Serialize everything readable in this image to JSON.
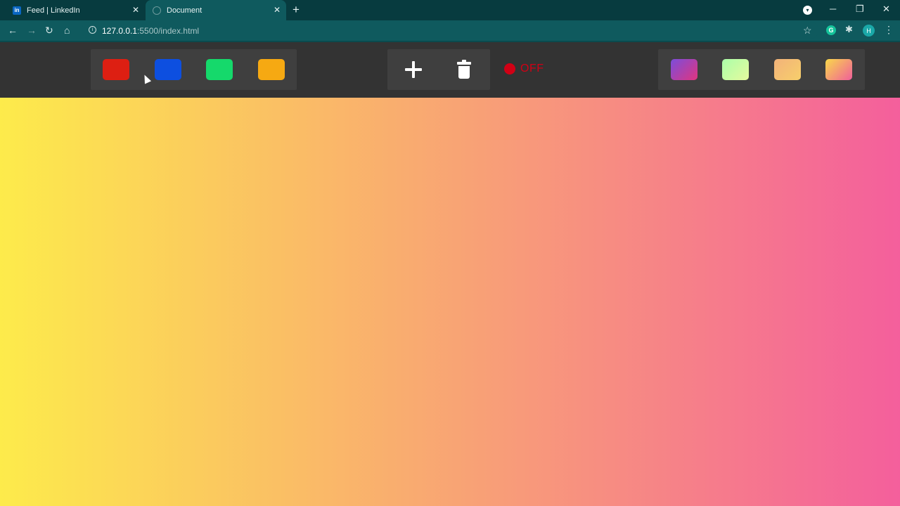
{
  "browser": {
    "tabs": [
      {
        "title": "Feed | LinkedIn",
        "favicon": "in"
      },
      {
        "title": "Document"
      }
    ],
    "url_host": "127.0.0.1",
    "url_rest": ":5500/index.html",
    "profile_initial": "H",
    "extension_initial": "G"
  },
  "solid_colors": [
    "#dd1f12",
    "#0d4fe0",
    "#15d96b",
    "#f6a912"
  ],
  "gradients": [
    [
      "#7b4ddb",
      "#e0357f"
    ],
    [
      "#aaffa9",
      "#e6f99e"
    ],
    [
      "#f2b27a",
      "#f7cf6b"
    ],
    [
      "#f9d94a",
      "#f05f9a"
    ]
  ],
  "status": {
    "text": "OFF",
    "color": "#d10015"
  },
  "canvas_gradient": [
    "#fdeb4b",
    "#f45f9c"
  ]
}
